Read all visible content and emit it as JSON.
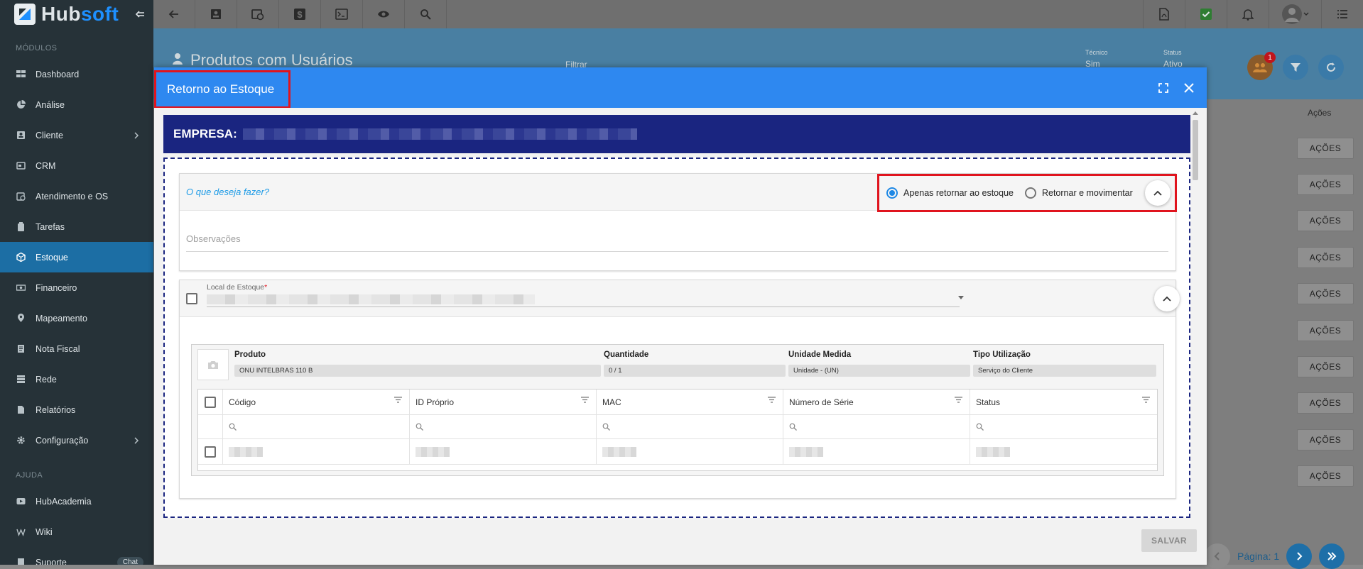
{
  "brand": {
    "name_part1": "Hub",
    "name_part2": "soft",
    "collapse_icon": "collapse-menu-icon"
  },
  "sidebar": {
    "section_modules": "MÓDULOS",
    "items": [
      {
        "label": "Dashboard",
        "icon": "dashboard-icon"
      },
      {
        "label": "Análise",
        "icon": "chart-pie-icon"
      },
      {
        "label": "Cliente",
        "icon": "id-card-icon",
        "has_children": true
      },
      {
        "label": "CRM",
        "icon": "crm-icon"
      },
      {
        "label": "Atendimento e OS",
        "icon": "clock-calendar-icon"
      },
      {
        "label": "Tarefas",
        "icon": "clipboard-icon"
      },
      {
        "label": "Estoque",
        "icon": "box-icon",
        "active": true
      },
      {
        "label": "Financeiro",
        "icon": "money-icon"
      },
      {
        "label": "Mapeamento",
        "icon": "map-pin-icon"
      },
      {
        "label": "Nota Fiscal",
        "icon": "document-icon"
      },
      {
        "label": "Rede",
        "icon": "network-icon"
      },
      {
        "label": "Relatórios",
        "icon": "report-icon"
      },
      {
        "label": "Configuração",
        "icon": "gear-icon",
        "has_children": true
      }
    ],
    "section_help": "AJUDA",
    "help_items": [
      {
        "label": "HubAcademia",
        "icon": "play-icon"
      },
      {
        "label": "Wiki",
        "icon": "wiki-icon"
      },
      {
        "label": "Suporte",
        "icon": "support-icon",
        "badge": "Chat"
      }
    ]
  },
  "background_page": {
    "title": "Produtos com Usuários",
    "filter_placeholder": "Filtrar",
    "tecnico_label": "Técnico",
    "tecnico_value": "Sim",
    "status_label": "Status",
    "status_value": "Ativo",
    "notification_count": "1",
    "acoes_header": "Ações",
    "acoes_button": "AÇÕES",
    "page_label": "Página: 1"
  },
  "modal": {
    "title": "Retorno ao Estoque",
    "empresa_label": "EMPRESA:",
    "question": "O que deseja fazer?",
    "options": [
      {
        "label": "Apenas retornar ao estoque",
        "selected": true
      },
      {
        "label": "Retornar e movimentar",
        "selected": false
      }
    ],
    "observacoes_placeholder": "Observações",
    "local_label": "Local de Estoque",
    "local_required": "*",
    "product": {
      "headers": [
        "Produto",
        "Quantidade",
        "Unidade Medida",
        "Tipo Utilização"
      ],
      "values": [
        "ONU INTELBRAS 110 B",
        "0 / 1",
        "Unidade - (UN)",
        "Serviço do Cliente"
      ]
    },
    "grid_columns": [
      "Código",
      "ID Próprio",
      "MAC",
      "Número de Série",
      "Status"
    ],
    "save_button": "SALVAR"
  },
  "colors": {
    "accent": "#2e88f0",
    "empresa_bar": "#1a2580",
    "highlight": "#e0141e",
    "sidebar": "#263238",
    "active_nav": "#1c6ea4"
  }
}
